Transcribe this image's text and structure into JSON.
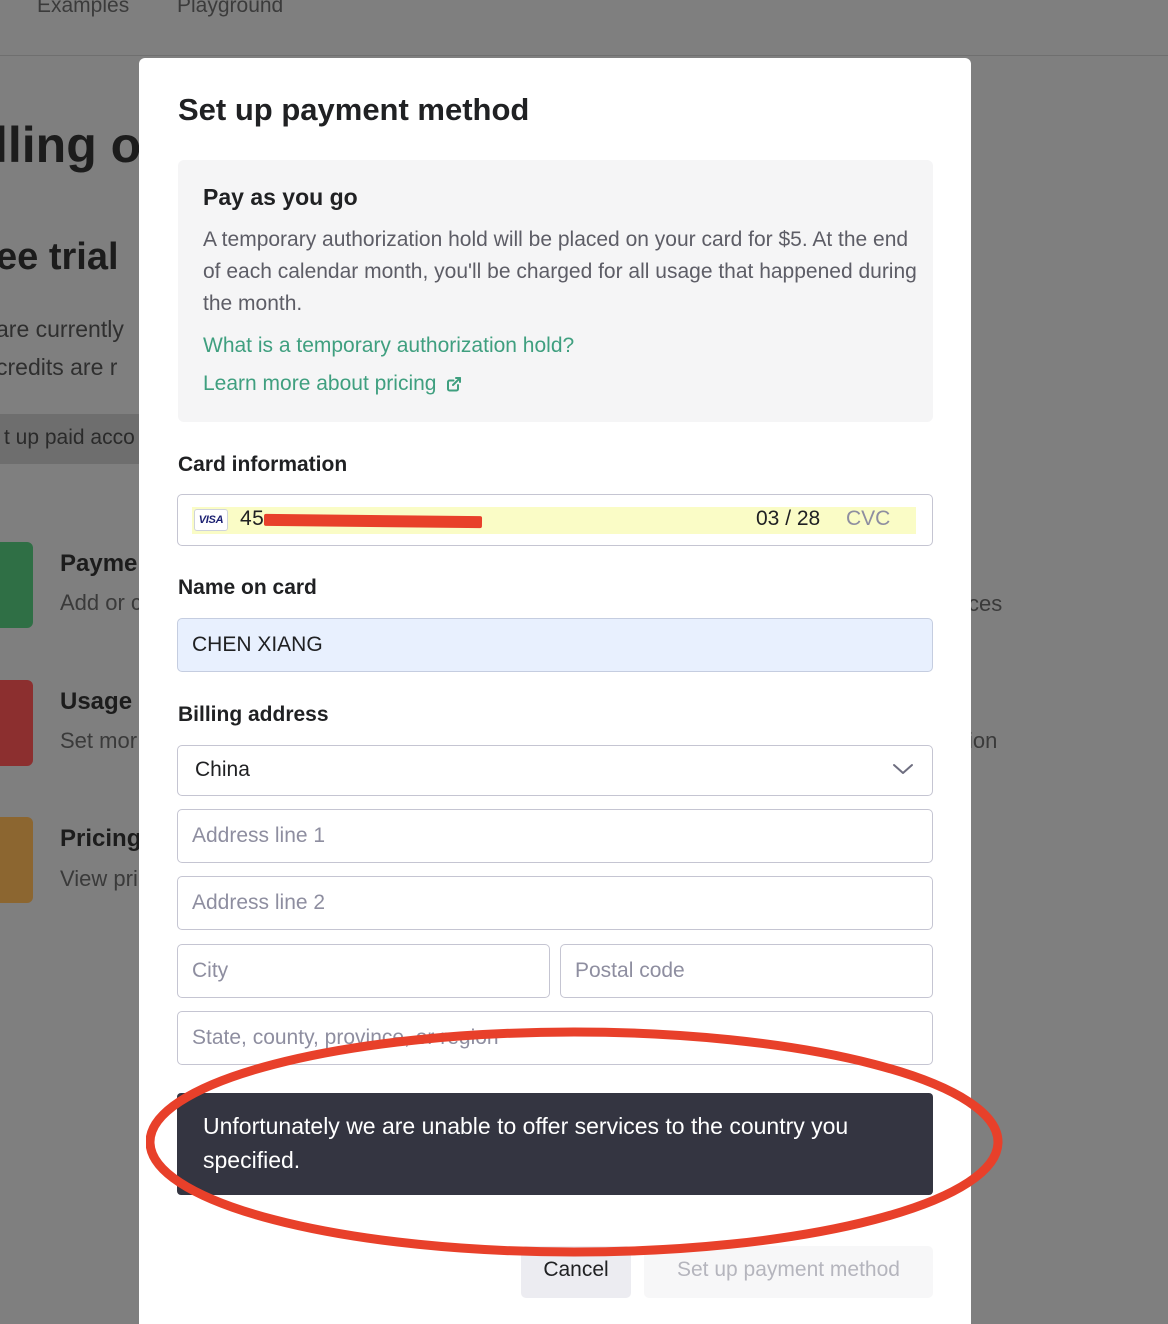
{
  "background": {
    "nav": {
      "examples": "Examples",
      "playground": "Playground"
    },
    "page_title": "lling o",
    "section_title": "ee trial",
    "desc_line1": "are currently",
    "desc_line2": "credits are r",
    "button_label": "t up paid acco",
    "cards": [
      {
        "title": "Payme",
        "desc": "Add or c",
        "right": "ces",
        "color": "#2f6f45"
      },
      {
        "title": "Usage",
        "desc": "Set mor",
        "right": "ion",
        "color": "#8c2f2f"
      },
      {
        "title": "Pricing",
        "desc": "View pri",
        "right": "",
        "color": "#8c6630"
      }
    ]
  },
  "modal": {
    "title": "Set up payment method",
    "info": {
      "heading": "Pay as you go",
      "body": "A temporary authorization hold will be placed on your card for $5. At the end of each calendar month, you'll be charged for all usage that happened during the month.",
      "link_hold": "What is a temporary authorization hold?",
      "link_pricing": "Learn more about pricing"
    },
    "card": {
      "label": "Card information",
      "brand": "VISA",
      "number": "45",
      "expiry": "03 / 28",
      "cvc_placeholder": "CVC"
    },
    "name": {
      "label": "Name on card",
      "value": "CHEN XIANG"
    },
    "billing": {
      "label": "Billing address",
      "country": "China",
      "address1_placeholder": "Address line 1",
      "address2_placeholder": "Address line 2",
      "city_placeholder": "City",
      "postal_placeholder": "Postal code",
      "state_placeholder": "State, county, province, or region"
    },
    "error_message": "Unfortunately we are unable to offer services to the country you specified.",
    "buttons": {
      "cancel": "Cancel",
      "submit": "Set up payment method"
    }
  },
  "colors": {
    "accent_link": "#3f9f7f",
    "toast_bg": "#343541",
    "annotation_red": "#e8402a",
    "autofill_name": "#e8f0fe",
    "autofill_card": "#fafcc6"
  }
}
